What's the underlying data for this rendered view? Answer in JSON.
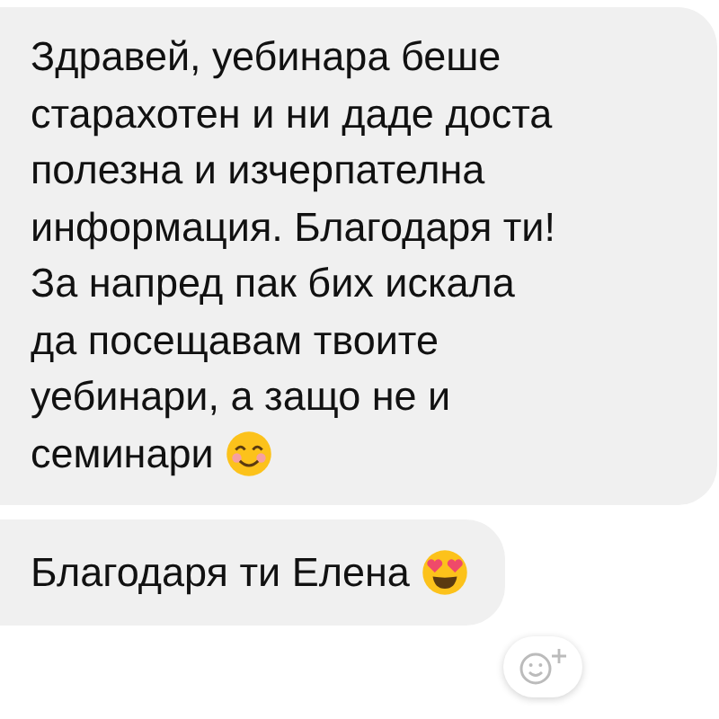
{
  "messages": [
    {
      "lines": [
        "Здравей, уебинара беше",
        "старахотен и ни даде доста",
        "полезна и изчерпателна",
        "информация. Благодаря ти!",
        "За напред пак бих искала",
        "да посещавам твоите",
        "уебинари, а защо не и",
        "семинари"
      ],
      "kind": "smiling"
    },
    {
      "lines": [
        "Благодаря ти Елена"
      ],
      "kind": "heart-eyes"
    }
  ]
}
